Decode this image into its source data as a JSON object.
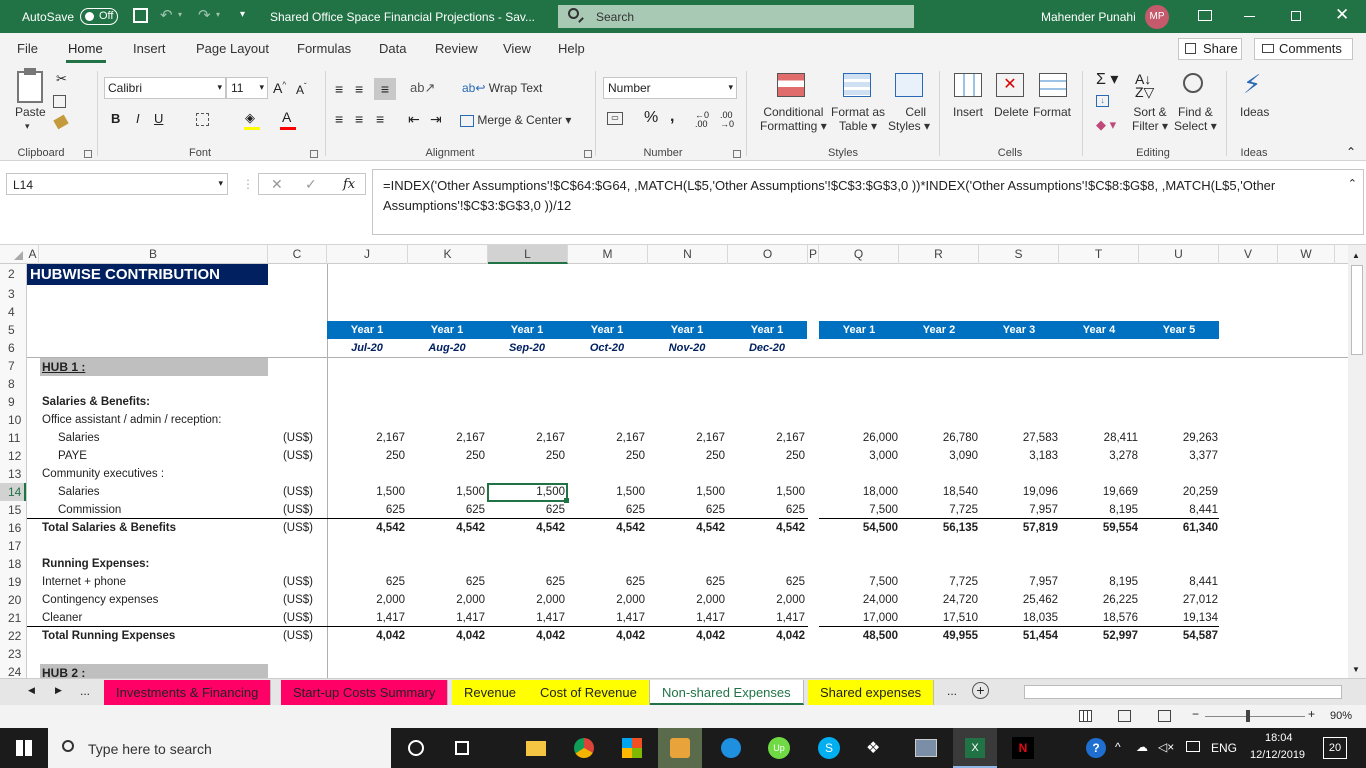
{
  "titlebar": {
    "autosave": "AutoSave",
    "toggle": "Off",
    "title": "Shared Office Space Financial Projections  -  Sav...",
    "search": "Search",
    "user": "Mahender Punahi",
    "initials": "MP"
  },
  "ribbon": {
    "tabs": [
      "File",
      "Home",
      "Insert",
      "Page Layout",
      "Formulas",
      "Data",
      "Review",
      "View",
      "Help"
    ],
    "share": "Share",
    "comments": "Comments",
    "font": "Calibri",
    "size": "11",
    "number_format": "Number",
    "wrap": "Wrap Text",
    "merge": "Merge & Center",
    "paste": "Paste",
    "cond1": "Conditional",
    "cond2": "Formatting",
    "fmt1": "Format as",
    "fmt2": "Table",
    "cell1": "Cell",
    "cell2": "Styles",
    "insert": "Insert",
    "delete": "Delete",
    "format": "Format",
    "sort1": "Sort &",
    "sort2": "Filter",
    "find1": "Find &",
    "find2": "Select",
    "ideas": "Ideas",
    "groups": {
      "clipboard": "Clipboard",
      "font": "Font",
      "alignment": "Alignment",
      "number": "Number",
      "styles": "Styles",
      "cells": "Cells",
      "editing": "Editing",
      "ideas": "Ideas"
    }
  },
  "formula": {
    "namebox": "L14",
    "fx": "fx",
    "line1": "=INDEX('Other Assumptions'!$C$64:$G64, ,MATCH(L$5,'Other Assumptions'!$C$3:$G$3,0 ))*INDEX('Other Assumptions'!$C$8:$G$8, ,MATCH(L$5,'Other",
    "line2": "Assumptions'!$C$3:$G$3,0 ))/12"
  },
  "columns": [
    "A",
    "B",
    "C",
    "J",
    "K",
    "L",
    "M",
    "N",
    "O",
    "P",
    "Q",
    "R",
    "S",
    "T",
    "U",
    "V",
    "W"
  ],
  "rows": [
    "2",
    "3",
    "4",
    "5",
    "6",
    "7",
    "8",
    "9",
    "10",
    "11",
    "12",
    "13",
    "14",
    "15",
    "16",
    "17",
    "18",
    "19",
    "20",
    "21",
    "22",
    "23",
    "24"
  ],
  "sheet": {
    "title": "HUBWISE CONTRIBUTION",
    "hub1": "HUB 1 :",
    "hub2": "HUB 2 :",
    "monthly_year": "Year 1",
    "months": [
      "Jul-20",
      "Aug-20",
      "Sep-20",
      "Oct-20",
      "Nov-20",
      "Dec-20"
    ],
    "years": [
      "Year 1",
      "Year 2",
      "Year 3",
      "Year 4",
      "Year 5"
    ],
    "lines": [
      {
        "row": 9,
        "label": "Salaries & Benefits:",
        "bold": true,
        "indent": 0
      },
      {
        "row": 10,
        "label": "Office assistant / admin / reception:",
        "indent": 0
      },
      {
        "row": 11,
        "label": "Salaries",
        "indent": 1,
        "unit": "(US$)",
        "m": [
          "2,167",
          "2,167",
          "2,167",
          "2,167",
          "2,167",
          "2,167"
        ],
        "y": [
          "26,000",
          "26,780",
          "27,583",
          "28,411",
          "29,263"
        ]
      },
      {
        "row": 12,
        "label": "PAYE",
        "indent": 1,
        "unit": "(US$)",
        "m": [
          "250",
          "250",
          "250",
          "250",
          "250",
          "250"
        ],
        "y": [
          "3,000",
          "3,090",
          "3,183",
          "3,278",
          "3,377"
        ]
      },
      {
        "row": 13,
        "label": "Community executives :",
        "indent": 0
      },
      {
        "row": 14,
        "label": "Salaries",
        "indent": 1,
        "unit": "(US$)",
        "m": [
          "1,500",
          "1,500",
          "1,500",
          "1,500",
          "1,500",
          "1,500"
        ],
        "y": [
          "18,000",
          "18,540",
          "19,096",
          "19,669",
          "20,259"
        ]
      },
      {
        "row": 15,
        "label": "Commission",
        "indent": 1,
        "unit": "(US$)",
        "m": [
          "625",
          "625",
          "625",
          "625",
          "625",
          "625"
        ],
        "y": [
          "7,500",
          "7,725",
          "7,957",
          "8,195",
          "8,441"
        ]
      },
      {
        "row": 16,
        "label": "Total Salaries & Benefits",
        "bold": true,
        "indent": 0,
        "unit": "(US$)",
        "m": [
          "4,542",
          "4,542",
          "4,542",
          "4,542",
          "4,542",
          "4,542"
        ],
        "y": [
          "54,500",
          "56,135",
          "57,819",
          "59,554",
          "61,340"
        ]
      },
      {
        "row": 18,
        "label": "Running Expenses:",
        "bold": true,
        "indent": 0
      },
      {
        "row": 19,
        "label": "Internet + phone",
        "indent": 0,
        "unit": "(US$)",
        "m": [
          "625",
          "625",
          "625",
          "625",
          "625",
          "625"
        ],
        "y": [
          "7,500",
          "7,725",
          "7,957",
          "8,195",
          "8,441"
        ]
      },
      {
        "row": 20,
        "label": "Contingency expenses",
        "indent": 0,
        "unit": "(US$)",
        "m": [
          "2,000",
          "2,000",
          "2,000",
          "2,000",
          "2,000",
          "2,000"
        ],
        "y": [
          "24,000",
          "24,720",
          "25,462",
          "26,225",
          "27,012"
        ]
      },
      {
        "row": 21,
        "label": "Cleaner",
        "indent": 0,
        "unit": "(US$)",
        "m": [
          "1,417",
          "1,417",
          "1,417",
          "1,417",
          "1,417",
          "1,417"
        ],
        "y": [
          "17,000",
          "17,510",
          "18,035",
          "18,576",
          "19,134"
        ]
      },
      {
        "row": 22,
        "label": "Total Running Expenses",
        "bold": true,
        "indent": 0,
        "unit": "(US$)",
        "m": [
          "4,042",
          "4,042",
          "4,042",
          "4,042",
          "4,042",
          "4,042"
        ],
        "y": [
          "48,500",
          "49,955",
          "51,454",
          "52,997",
          "54,587"
        ]
      }
    ]
  },
  "tabs": [
    {
      "label": "Investments & Financing",
      "color": "#ff0066"
    },
    {
      "label": "Start-up Costs Summary",
      "color": "#ff0066"
    },
    {
      "label": "Revenue",
      "color": "#ffff00"
    },
    {
      "label": "Cost of Revenue",
      "color": "#ffff00"
    },
    {
      "label": "Non-shared Expenses",
      "color": "#ffffff"
    },
    {
      "label": "Shared expenses",
      "color": "#ffff00"
    }
  ],
  "status": {
    "zoom": "90%"
  },
  "taskbar": {
    "search": "Type here to search",
    "lang": "ENG",
    "time": "18:04",
    "date": "12/12/2019",
    "notif": "20"
  },
  "colors": {
    "excel_green": "#217346",
    "header_navy": "#002060",
    "header_blue": "#0070c0",
    "hub_grey": "#bfbfbf"
  }
}
